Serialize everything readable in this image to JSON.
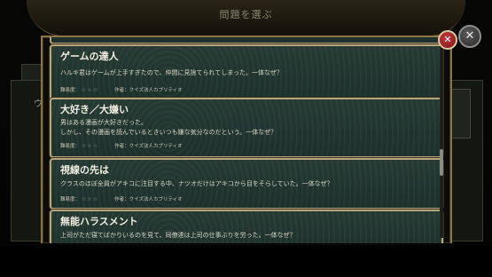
{
  "header": {
    "title": "問題を選ぶ"
  },
  "background": {
    "left_text": "ウ"
  },
  "labels": {
    "difficulty": "難易度：",
    "stars": "☆☆☆",
    "author": "作者：クイズ法人カプリティオ"
  },
  "puzzles": [
    {
      "title": "ゲームの達人",
      "lines": [
        "ハルキ君はゲームが上手すぎたので、仲間に見捨てられてしまった。一体なぜ？"
      ]
    },
    {
      "title": "大好き／大嫌い",
      "lines": [
        "男はある漫画が大好きだった。",
        "しかし、その漫画を読んでいるときいつも嫌な気分なのだという。一体なぜ？"
      ]
    },
    {
      "title": "視線の先は",
      "lines": [
        "クラスのほぼ全員がアキコに注目する中、ナツオだけはアキコから目をそらしていた。一体なぜ？"
      ]
    },
    {
      "title": "無能ハラスメント",
      "lines": [
        "上司がただ寝てばかりいるのを見て、同僚達は上司の仕事ぶりを労った。一体なぜ？"
      ]
    }
  ],
  "buttons": {
    "close_icon": "✕",
    "close_icon_alt": "✕"
  },
  "colors": {
    "accent_gold": "#b7a679",
    "card_teal": "#233631",
    "close_red": "#b52a2e"
  }
}
